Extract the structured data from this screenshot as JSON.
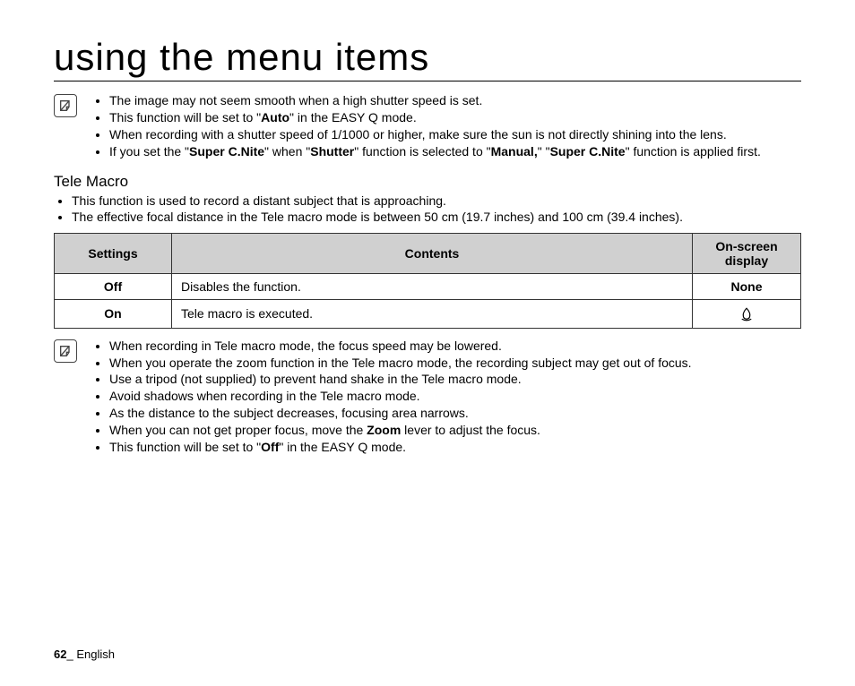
{
  "title": "using the menu items",
  "notes1": {
    "b1": "The image may not seem smooth when a high shutter speed is set.",
    "b2_pre": "This function will be set to \"",
    "b2_bold": "Auto",
    "b2_post": "\" in the EASY Q mode.",
    "b3": "When recording with a shutter speed of 1/1000 or higher, make sure the sun is not directly shining into the lens.",
    "b4_p1": "If you set the \"",
    "b4_b1": "Super C.Nite",
    "b4_p2": "\" when \"",
    "b4_b2": "Shutter",
    "b4_p3": "\" function is selected to \"",
    "b4_b3": "Manual,",
    "b4_p4": "\" \"",
    "b4_b4": "Super C.Nite",
    "b4_p5": "\" function is applied first."
  },
  "section": {
    "heading": "Tele Macro",
    "intro1": "This function is used to record a distant subject that is approaching.",
    "intro2": "The effective focal distance in the Tele macro mode is between 50 cm (19.7 inches) and 100 cm (39.4 inches)."
  },
  "table": {
    "h1": "Settings",
    "h2": "Contents",
    "h3": "On-screen display",
    "r1c1": "Off",
    "r1c2": "Disables the function.",
    "r1c3": "None",
    "r2c1": "On",
    "r2c2": "Tele macro is executed."
  },
  "notes2": {
    "b1": "When recording in Tele macro mode, the focus speed may be lowered.",
    "b2": "When you operate the zoom function in the Tele macro mode, the recording subject may get out of focus.",
    "b3": "Use a tripod (not supplied) to prevent hand shake in the Tele macro mode.",
    "b4": "Avoid shadows when recording in the Tele macro mode.",
    "b5": "As the distance to the subject decreases, focusing area narrows.",
    "b6_pre": "When you can not get proper focus, move the ",
    "b6_bold": "Zoom",
    "b6_post": " lever to adjust the focus.",
    "b7_pre": "This function will be set to \"",
    "b7_bold": "Off",
    "b7_post": "\" in the EASY Q mode."
  },
  "footer": {
    "page": "62",
    "sep": "_ ",
    "lang": "English"
  }
}
